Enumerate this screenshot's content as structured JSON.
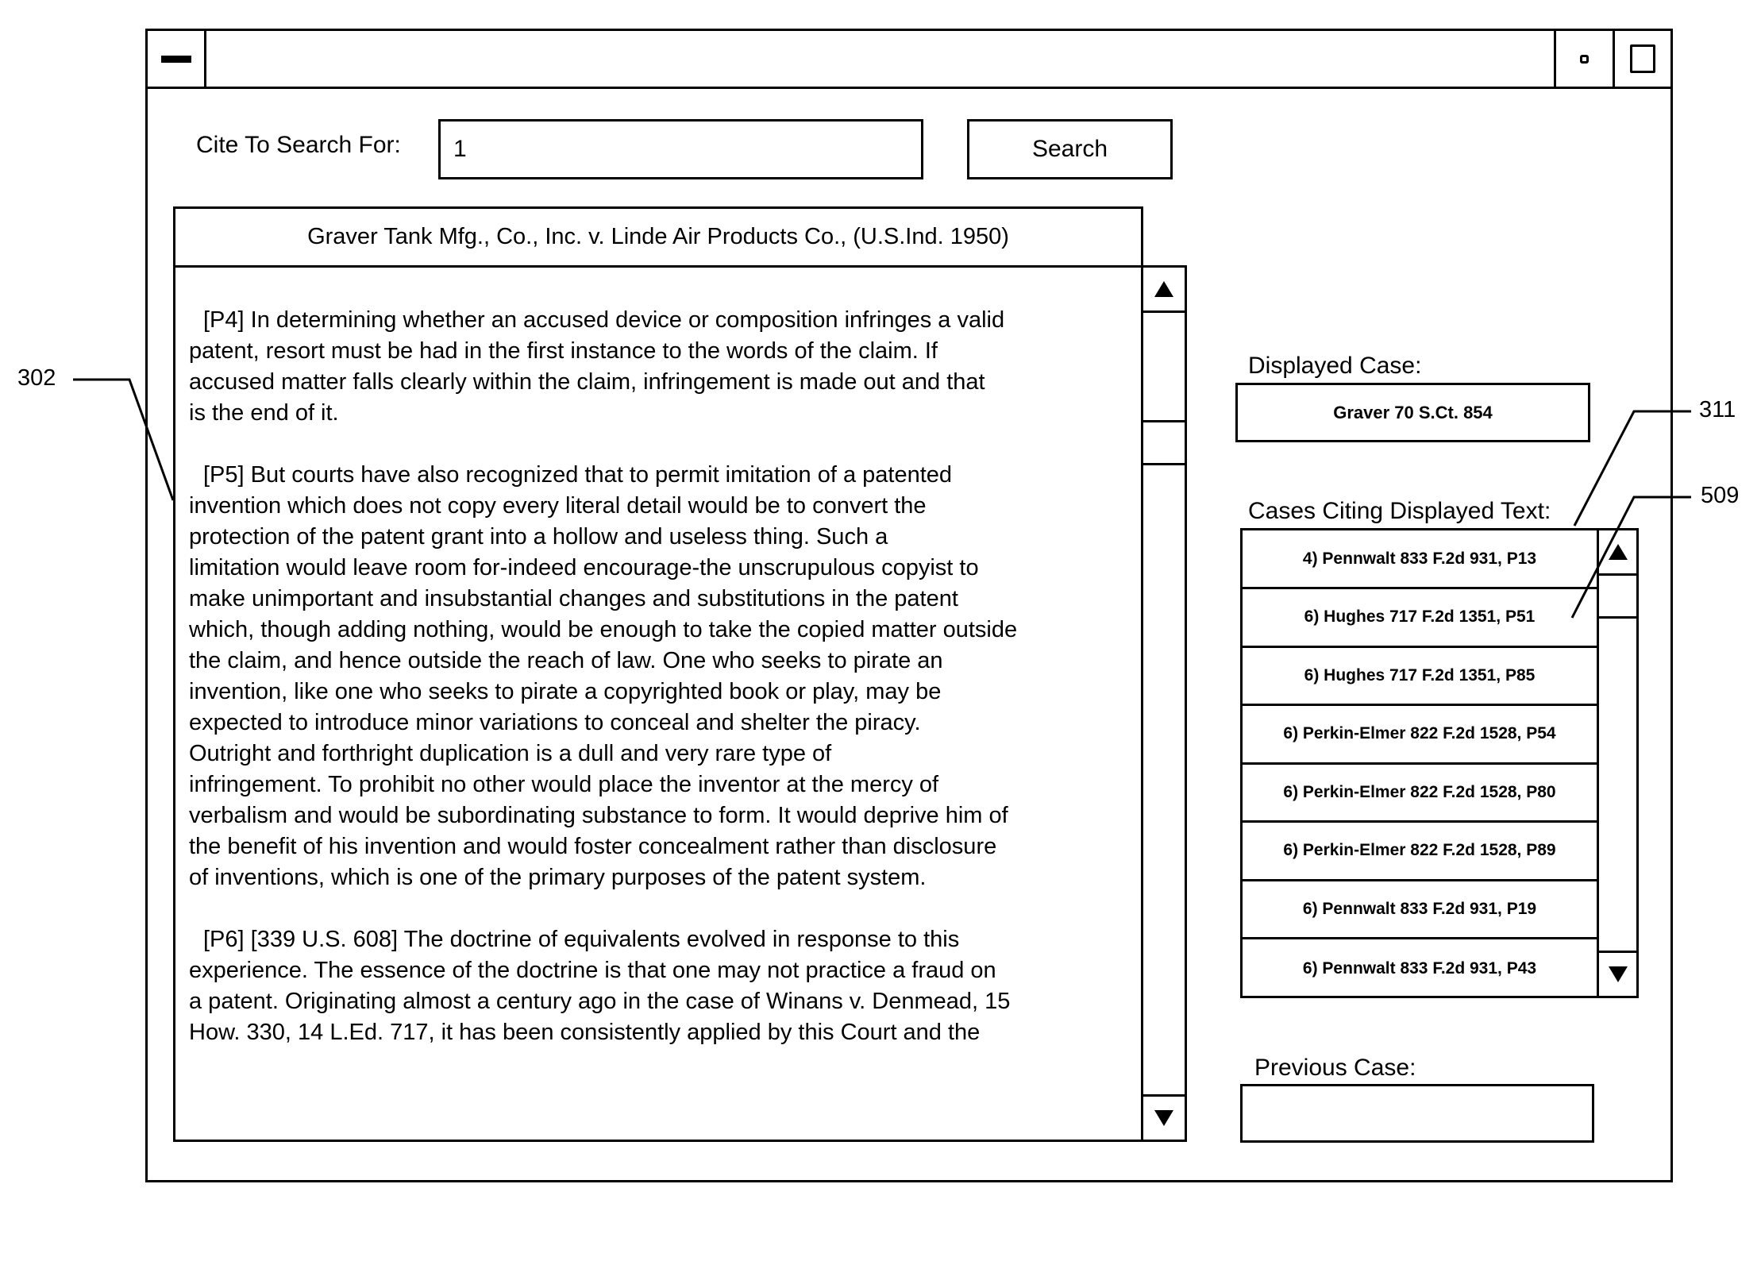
{
  "window": {
    "title": "",
    "controls": {
      "system_menu_icon": "minus-bar-icon",
      "restore_icon": "small-square-icon",
      "maximize_icon": "square-icon"
    }
  },
  "search": {
    "label": "Cite To Search For:",
    "value": "1",
    "button_label": "Search"
  },
  "document": {
    "title": "Graver Tank Mfg., Co., Inc. v. Linde Air Products Co., (U.S.Ind. 1950)",
    "paragraphs": [
      [
        "[P4] In determining whether an accused device or composition infringes a valid",
        "patent, resort must be had in the first instance to the words of the claim.  If",
        "accused matter falls clearly within the claim, infringement is made out and that",
        "is the end of it."
      ],
      [
        "[P5] But courts have also recognized that to permit imitation of a patented",
        "invention which does not copy every literal detail would be to convert the",
        "protection of the patent grant into a hollow and useless thing.  Such a",
        "limitation would leave room for-indeed encourage-the unscrupulous copyist to",
        "make unimportant and insubstantial changes and substitutions in the patent",
        "which, though adding nothing, would be enough to take the copied matter outside",
        "the claim, and hence outside the reach of law.  One who seeks to pirate an",
        "invention, like one who seeks to pirate a copyrighted  book or play, may be",
        "expected to introduce minor variations to conceal and shelter the piracy.",
        "Outright and forthright duplication is a dull and very rare type of",
        "infringement.  To prohibit no other would place the inventor at the mercy of",
        "verbalism and would be subordinating substance to form.  It would deprive him of",
        "the benefit of his invention and would foster concealment rather than disclosure",
        "of inventions, which is one of the primary purposes of the patent system."
      ],
      [
        "[P6] [339 U.S. 608] The doctrine of equivalents evolved in response to this",
        "experience.  The essence of the doctrine is that one may not practice a fraud on",
        "a patent.  Originating almost a century ago in the case of Winans v. Denmead, 15",
        "How. 330, 14 L.Ed. 717, it has been consistently applied by this Court and the"
      ]
    ],
    "scrollbar": {
      "up_icon": "triangle-up-icon",
      "down_icon": "triangle-down-icon"
    }
  },
  "displayed_case": {
    "label": "Displayed Case:",
    "value": "Graver 70 S.Ct. 854"
  },
  "citing_cases": {
    "label": "Cases Citing Displayed Text:",
    "items": [
      "4) Pennwalt 833 F.2d 931, P13",
      "6) Hughes 717 F.2d 1351, P51",
      "6) Hughes 717 F.2d 1351, P85",
      "6) Perkin-Elmer 822 F.2d 1528, P54",
      "6) Perkin-Elmer 822 F.2d 1528, P80",
      "6) Perkin-Elmer 822 F.2d 1528, P89",
      "6) Pennwalt 833 F.2d 931, P19",
      "6) Pennwalt 833 F.2d 931, P43"
    ]
  },
  "previous_case": {
    "label": "Previous Case:",
    "value": ""
  },
  "callouts": {
    "document_pane": "302",
    "citing_list": "311",
    "list_item": "509"
  }
}
